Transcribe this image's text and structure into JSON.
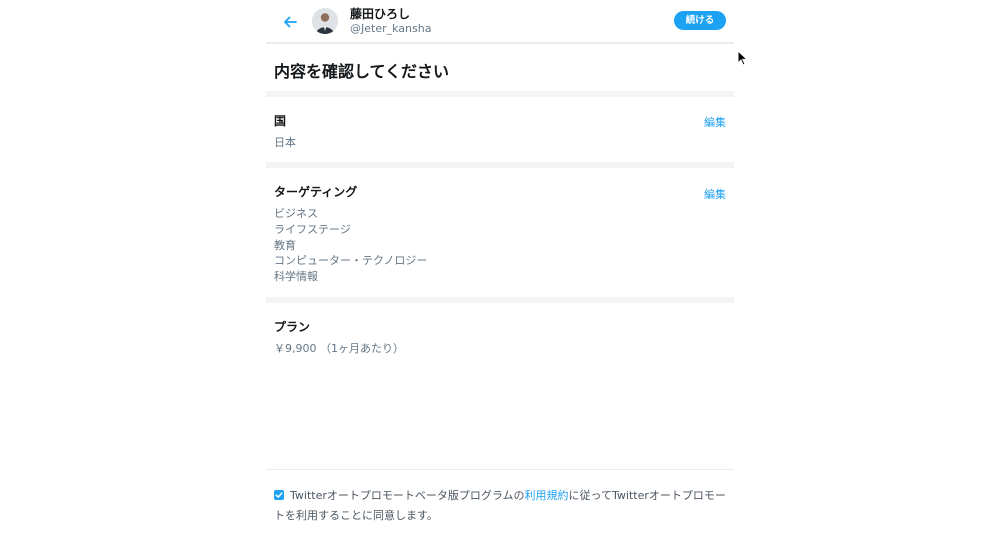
{
  "header": {
    "user_name": "藤田ひろし",
    "user_handle": "@Jeter_kansha",
    "continue_label": "続ける"
  },
  "page_title": "内容を確認してください",
  "sections": {
    "country": {
      "label": "国",
      "edit_label": "編集",
      "value": "日本"
    },
    "targeting": {
      "label": "ターゲティング",
      "edit_label": "編集",
      "values": [
        "ビジネス",
        "ライフステージ",
        "教育",
        "コンピューター・テクノロジー",
        "科学情報"
      ]
    },
    "plan": {
      "label": "プラン",
      "value": "￥9,900 （1ヶ月あたり）"
    }
  },
  "consent": {
    "checked": true,
    "text_before": "Twitterオートプロモートベータ版プログラムの",
    "terms_link": "利用規約",
    "text_after": "に従ってTwitterオートプロモートを利用することに同意します。"
  },
  "colors": {
    "accent": "#1da1f2",
    "secondary_text": "#657786",
    "divider": "#f2f4f5"
  }
}
